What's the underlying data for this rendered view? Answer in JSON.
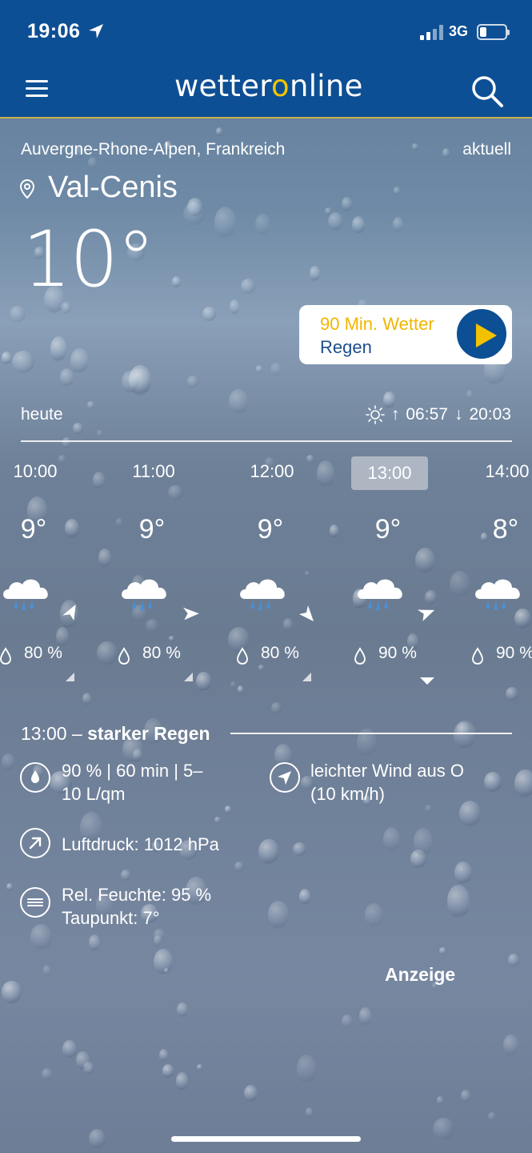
{
  "status_bar": {
    "time": "19:06",
    "network": "3G"
  },
  "header": {
    "logo_part1": "wetter",
    "logo_o": "o",
    "logo_part2": "nline"
  },
  "location": {
    "region": "Auvergne-Rhone-Alpen, Frankreich",
    "mode": "aktuell",
    "city": "Val-Cenis",
    "temperature": "10°"
  },
  "promo": {
    "title": "90 Min. Wetter",
    "subtitle": "Regen"
  },
  "day": {
    "label": "heute",
    "sunrise": "06:57",
    "sunset": "20:03"
  },
  "hourly": [
    {
      "time": "10:00",
      "temp": "9°",
      "precip": "80 %",
      "selected": false
    },
    {
      "time": "11:00",
      "temp": "9°",
      "precip": "80 %",
      "selected": false
    },
    {
      "time": "12:00",
      "temp": "9°",
      "precip": "80 %",
      "selected": false
    },
    {
      "time": "13:00",
      "temp": "9°",
      "precip": "90 %",
      "selected": true
    },
    {
      "time": "14:00",
      "temp": "8°",
      "precip": "90 %",
      "selected": false
    }
  ],
  "detail": {
    "time": "13:00",
    "separator": "–",
    "condition": "starker Regen",
    "precip_line1": "90 % | 60 min | 5–",
    "precip_line2": "10 L/qm",
    "wind_line1": "leichter Wind aus O",
    "wind_line2": "(10 km/h)",
    "pressure": "Luftdruck: 1012 hPa",
    "humidity": "Rel. Feuchte: 95 %",
    "dewpoint": "Taupunkt: 7°"
  },
  "ad_label": "Anzeige",
  "colors": {
    "header_bg": "#0d4f94",
    "accent_yellow": "#f2c200",
    "promo_text": "#1c4f8c"
  }
}
